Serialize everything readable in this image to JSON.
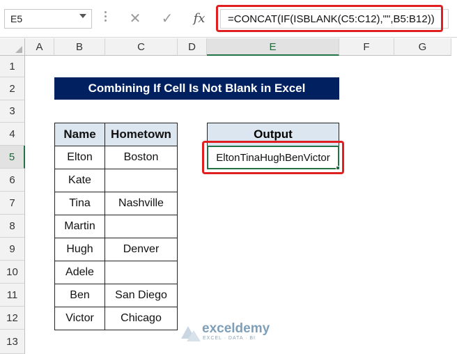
{
  "formula_bar": {
    "name_box": "E5",
    "cancel_icon": "✕",
    "enter_icon": "✓",
    "fx_label": "fx",
    "formula": "=CONCAT(IF(ISBLANK(C5:C12),\"\",B5:B12))"
  },
  "columns": [
    "A",
    "B",
    "C",
    "D",
    "E",
    "F",
    "G"
  ],
  "rows": [
    "1",
    "2",
    "3",
    "4",
    "5",
    "6",
    "7",
    "8",
    "9",
    "10",
    "11",
    "12",
    "13"
  ],
  "selected_cell": {
    "column": "E",
    "row": "5"
  },
  "sheet": {
    "title": "Combining If Cell Is Not Blank in Excel",
    "table": {
      "headers": [
        "Name",
        "Hometown"
      ],
      "rows": [
        [
          "Elton",
          "Boston"
        ],
        [
          "Kate",
          ""
        ],
        [
          "Tina",
          "Nashville"
        ],
        [
          "Martin",
          ""
        ],
        [
          "Hugh",
          "Denver"
        ],
        [
          "Adele",
          ""
        ],
        [
          "Ben",
          "San Diego"
        ],
        [
          "Victor",
          "Chicago"
        ]
      ]
    },
    "output": {
      "header": "Output",
      "value": "EltonTinaHughBenVictor"
    }
  },
  "watermark": {
    "name": "exceldemy",
    "tagline": "EXCEL · DATA · BI"
  },
  "colors": {
    "title_bg": "#002060",
    "header_bg": "#dce6f1",
    "highlight": "#e02020",
    "selection": "#217346"
  }
}
